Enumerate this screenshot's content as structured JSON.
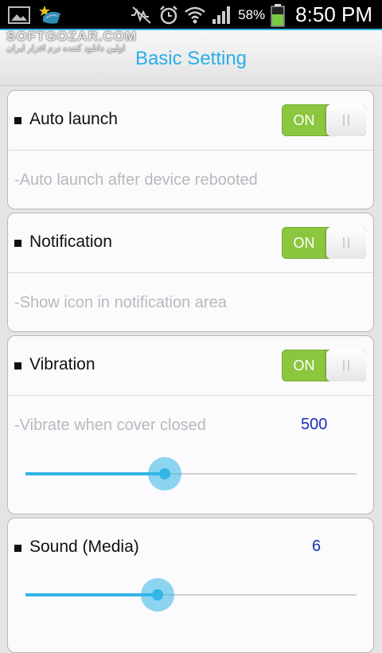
{
  "status_bar": {
    "battery_text": "58%",
    "time": "8:50 PM",
    "icons": [
      "image-icon",
      "app-icon",
      "mute-icon",
      "alarm-icon",
      "wifi-icon",
      "signal-icon",
      "battery-icon"
    ]
  },
  "watermark": {
    "main": "SOFTGOZAR.COM",
    "sub": "اولین دانلود کننده نرم افزار ایران"
  },
  "header": {
    "title": "Basic Setting"
  },
  "colors": {
    "accent": "#33b5e5",
    "title": "#2aaee6",
    "toggle_on": "#8cc63f",
    "value": "#1a2fb8"
  },
  "settings": {
    "auto_launch": {
      "label": "Auto launch",
      "toggle": "ON",
      "enabled": true,
      "description": "-Auto launch after device rebooted"
    },
    "notification": {
      "label": "Notification",
      "toggle": "ON",
      "enabled": true,
      "description": "-Show icon in notification area"
    },
    "vibration": {
      "label": "Vibration",
      "toggle": "ON",
      "enabled": true,
      "description": "-Vibrate when cover closed",
      "value": "500",
      "slider_fraction": 0.42
    },
    "sound": {
      "label": "Sound (Media)",
      "value": "6",
      "slider_fraction": 0.4
    }
  }
}
